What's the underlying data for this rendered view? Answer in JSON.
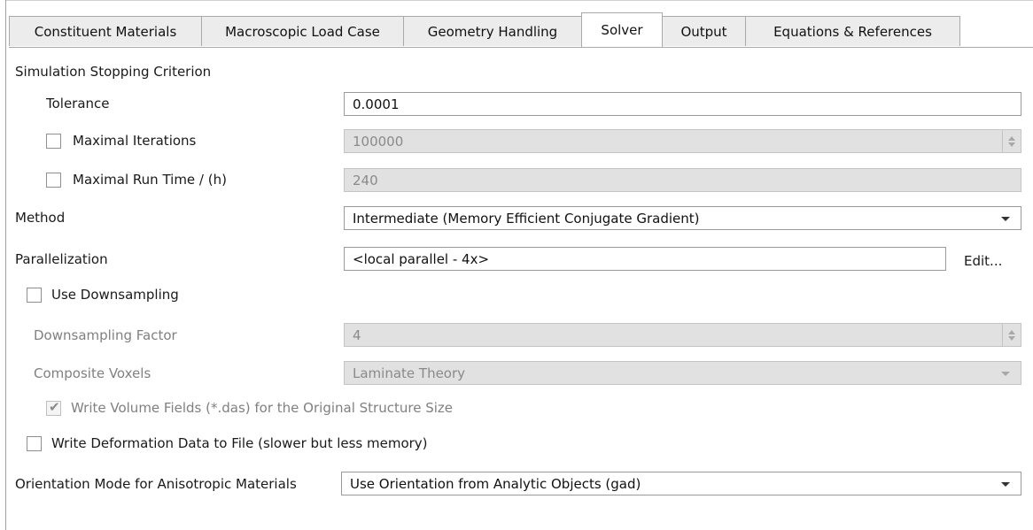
{
  "tabs": [
    {
      "label": "Constituent Materials"
    },
    {
      "label": "Macroscopic Load Case"
    },
    {
      "label": "Geometry Handling"
    },
    {
      "label": "Solver"
    },
    {
      "label": "Output"
    },
    {
      "label": "Equations & References"
    }
  ],
  "active_tab": "Solver",
  "stopping": {
    "section_label": "Simulation Stopping Criterion",
    "tolerance_label": "Tolerance",
    "tolerance_value": "0.0001",
    "max_iter_label": "Maximal Iterations",
    "max_iter_checked": false,
    "max_iter_value": "100000",
    "max_runtime_label": "Maximal Run Time / (h)",
    "max_runtime_checked": false,
    "max_runtime_value": "240"
  },
  "method": {
    "label": "Method",
    "value": "Intermediate (Memory Efficient Conjugate Gradient)"
  },
  "parallelization": {
    "label": "Parallelization",
    "value": "<local parallel - 4x>",
    "edit_label": "Edit..."
  },
  "downsampling": {
    "label": "Use Downsampling",
    "checked": false,
    "factor_label": "Downsampling Factor",
    "factor_value": "4",
    "composite_label": "Composite Voxels",
    "composite_value": "Laminate Theory",
    "write_volume_label": "Write Volume Fields (*.das) for the Original Structure Size",
    "write_volume_checked": true
  },
  "deformation": {
    "label": "Write Deformation Data to File (slower but less memory)",
    "checked": false
  },
  "orientation": {
    "label": "Orientation Mode for Anisotropic Materials",
    "value": "Use Orientation from Analytic Objects (gad)"
  }
}
